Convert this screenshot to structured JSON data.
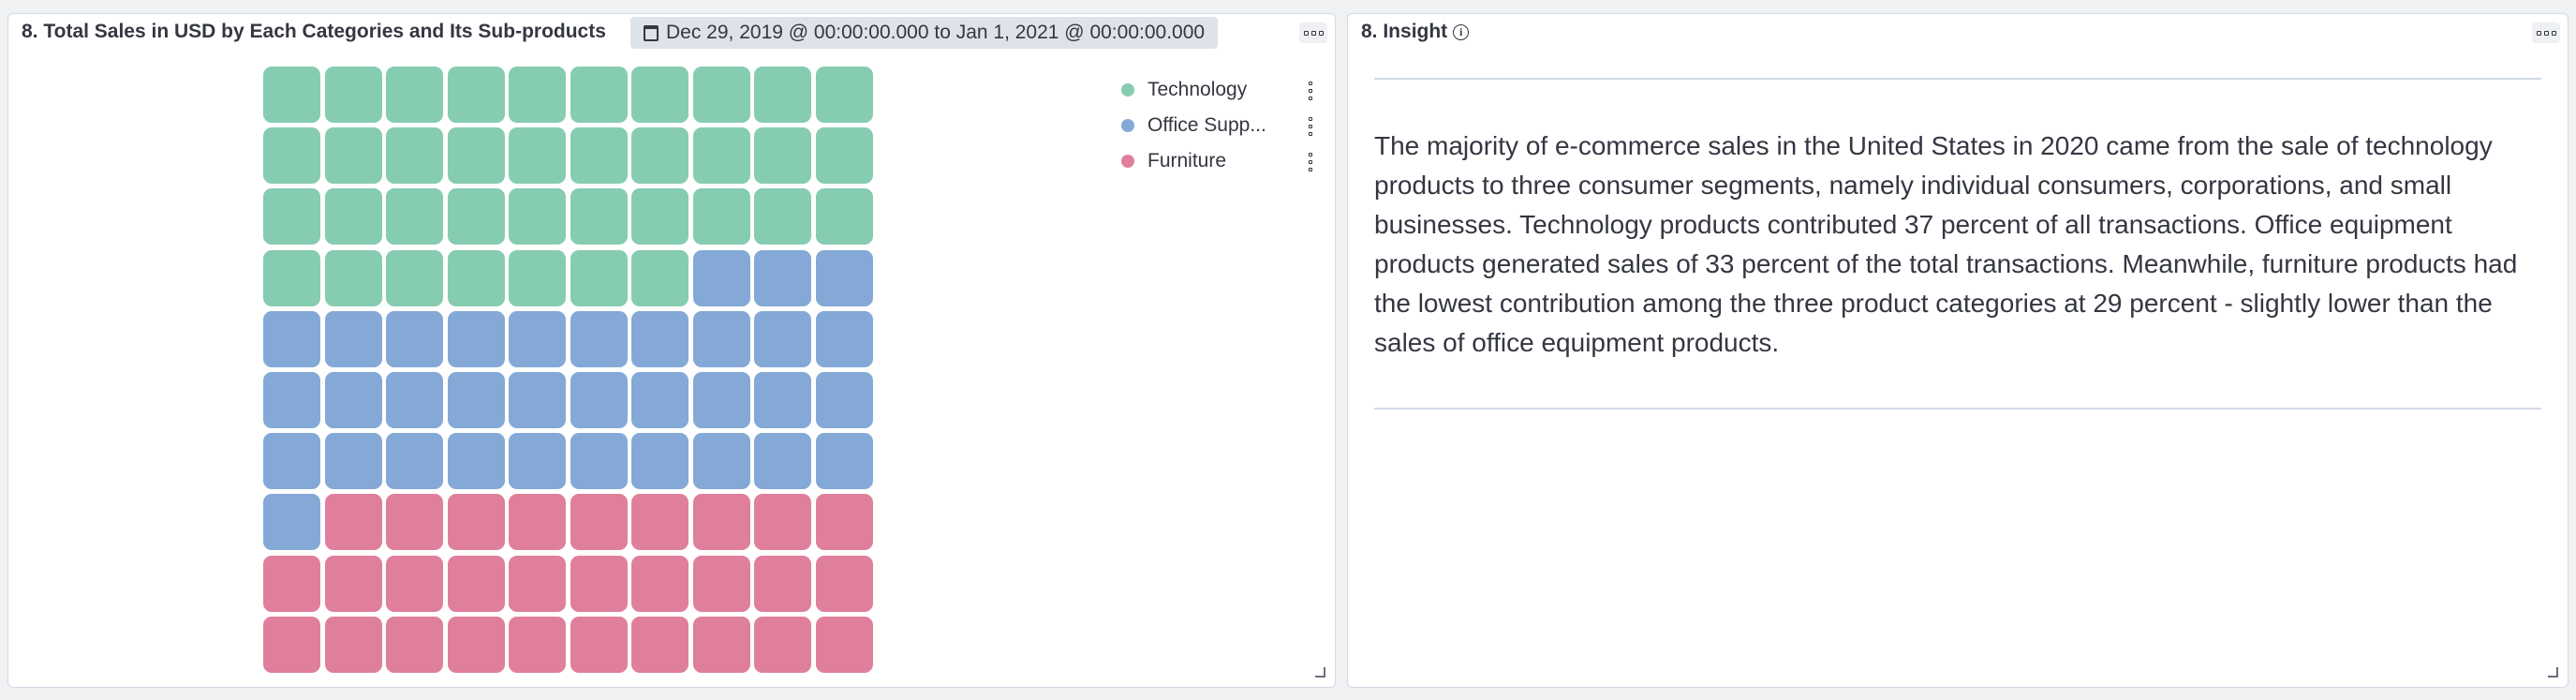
{
  "left_panel": {
    "title": "8. Total Sales in USD by Each Categories and Its Sub-products",
    "time_range": "Dec 29, 2019 @ 00:00:00.000 to Jan 1, 2021 @ 00:00:00.000",
    "menu_icon": "options-icon",
    "calendar_icon": "calendar-icon"
  },
  "chart_data": {
    "type": "waffle",
    "grid": {
      "rows": 10,
      "cols": 10
    },
    "categories": [
      "Technology",
      "Office Supp...",
      "Furniture"
    ],
    "values": [
      37,
      34,
      29
    ],
    "colors": [
      "#86ccb1",
      "#84a9d6",
      "#e07f9b"
    ],
    "legend_position": "top-right"
  },
  "right_panel": {
    "title": "8. Insight",
    "info_icon": "info-icon",
    "menu_icon": "options-icon",
    "body": "The majority of e-commerce sales in the United States in 2020 came from the sale of technology products to three consumer segments, namely individual consumers, corporations, and small businesses. Technology products contributed 37 percent of all transactions. Office equipment products generated sales of 33 percent of the total transactions. Meanwhile, furniture products had the lowest contribution among the three product categories at 29 percent - slightly lower than the sales of office equipment products."
  }
}
